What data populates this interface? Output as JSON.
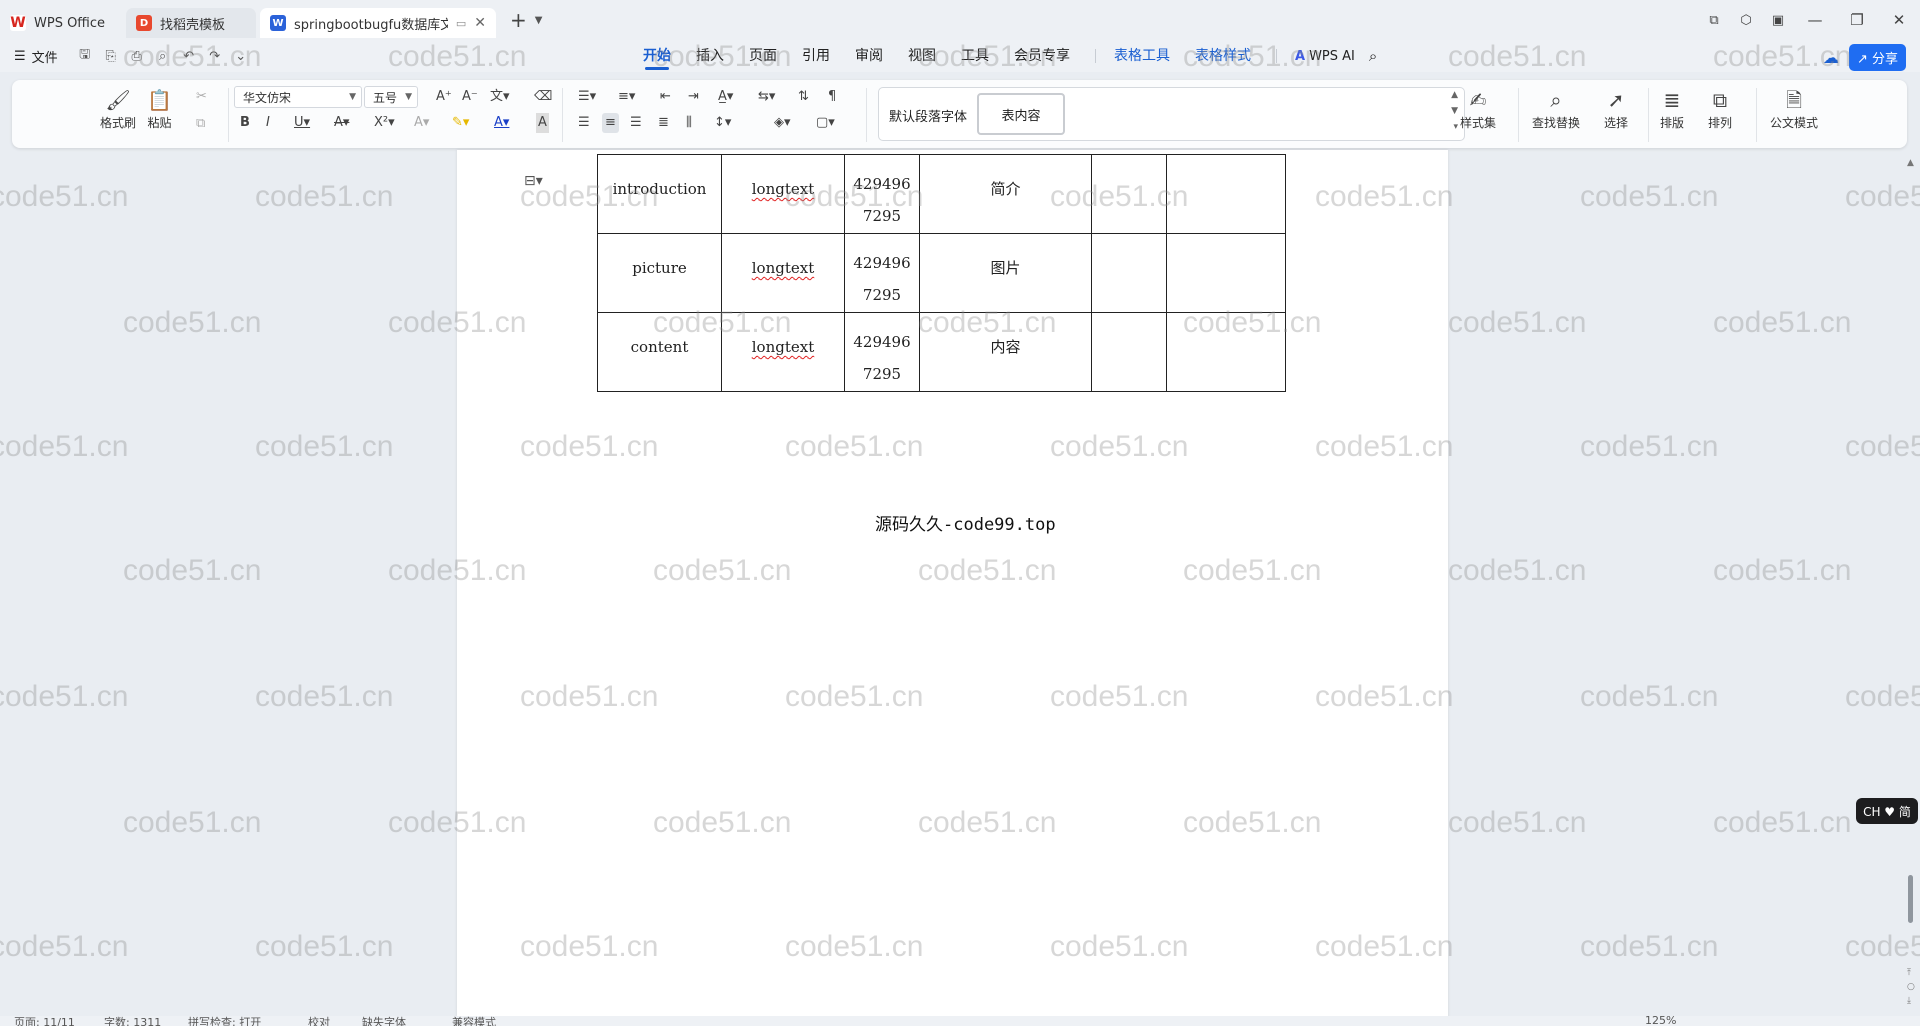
{
  "tabs": [
    {
      "label": "WPS Office",
      "icon": "wps-logo-icon"
    },
    {
      "label": "找稻壳模板",
      "icon": "docer-icon"
    },
    {
      "label": "springbootbugfu数据库文档",
      "icon": "word-doc-icon"
    }
  ],
  "menu": {
    "file": "文件",
    "tabs": [
      "开始",
      "插入",
      "页面",
      "引用",
      "审阅",
      "视图",
      "工具",
      "会员专享"
    ],
    "context_tabs": [
      "表格工具",
      "表格样式"
    ],
    "wps_ai": "WPS AI",
    "share": "分享"
  },
  "ribbon": {
    "format_painter": "格式刷",
    "paste": "粘贴",
    "font_name": "华文仿宋",
    "font_size": "五号",
    "style_default": "默认段落字体",
    "style_current": "表内容",
    "style_set": "样式集",
    "find_replace": "查找替换",
    "select": "选择",
    "typeset": "排版",
    "arrange": "排列",
    "official_mode": "公文模式"
  },
  "doc": {
    "rows": [
      {
        "field": "introduction",
        "type": "longtext",
        "len1": "429496",
        "len2": "7295",
        "comment": "简介"
      },
      {
        "field": "picture",
        "type": "longtext",
        "len1": "429496",
        "len2": "7295",
        "comment": "图片"
      },
      {
        "field": "content",
        "type": "longtext",
        "len1": "429496",
        "len2": "7295",
        "comment": "内容"
      }
    ],
    "source": "源码久久-code99.top"
  },
  "watermark": "code51.cn",
  "ime": "CH ♥ 简",
  "status": {
    "page": "页面: 11/11",
    "words": "字数: 1311",
    "spell": "拼写检查: 打开",
    "proof": "校对",
    "font_missing": "缺失字体",
    "compat": "兼容模式",
    "zoom": "125%"
  },
  "colors": {
    "accent": "#1a5fd1",
    "share_bg": "#1f6df2",
    "brand_red": "#d7261f"
  }
}
